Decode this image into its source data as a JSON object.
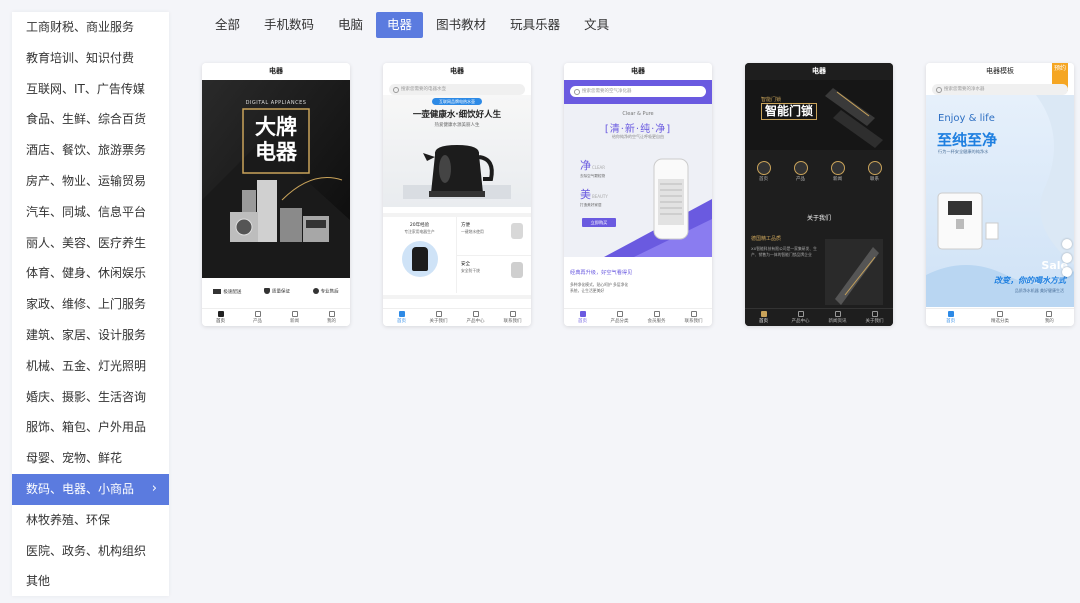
{
  "sidebar": {
    "items": [
      {
        "label": "工商财税、商业服务"
      },
      {
        "label": "教育培训、知识付费"
      },
      {
        "label": "互联网、IT、广告传媒"
      },
      {
        "label": "食品、生鲜、综合百货"
      },
      {
        "label": "酒店、餐饮、旅游票务"
      },
      {
        "label": "房产、物业、运输贸易"
      },
      {
        "label": "汽车、同城、信息平台"
      },
      {
        "label": "丽人、美容、医疗养生"
      },
      {
        "label": "体育、健身、休闲娱乐"
      },
      {
        "label": "家政、维修、上门服务"
      },
      {
        "label": "建筑、家居、设计服务"
      },
      {
        "label": "机械、五金、灯光照明"
      },
      {
        "label": "婚庆、摄影、生活咨询"
      },
      {
        "label": "服饰、箱包、户外用品"
      },
      {
        "label": "母婴、宠物、鲜花"
      },
      {
        "label": "数码、电器、小商品"
      },
      {
        "label": "林牧养殖、环保"
      },
      {
        "label": "医院、政务、机构组织"
      },
      {
        "label": "其他"
      }
    ],
    "active_index": 15,
    "chevron": "›"
  },
  "tabs": [
    "全部",
    "手机数码",
    "电脑",
    "电器",
    "图书教材",
    "玩具乐器",
    "文具"
  ],
  "active_tab": 3,
  "colors": {
    "accent": "#5b7bdf",
    "purple": "#6a5ae0",
    "blue": "#2d8ae6"
  },
  "cards": {
    "c1": {
      "title": "电器",
      "brand_en": "DIGITAL APPLIANCES",
      "headline_1": "大牌",
      "headline_2": "电器",
      "features": [
        "极速配送",
        "质量保证",
        "专业售后"
      ],
      "nav": [
        "首页",
        "产品",
        "新闻",
        "我的"
      ]
    },
    "c2": {
      "title": "电器",
      "search": "搜索您需要的电器水壶",
      "badge": "互联网品牌电热水壶",
      "headline": "一壶健康水·细饮好人生",
      "sub": "热爱健康水源美丽人生",
      "grid": [
        {
          "t": "20年经验",
          "s": "专注家用电器生产"
        },
        {
          "t": "方便",
          "s": "一键烧水使用"
        },
        {
          "t": "安全",
          "s": "安全防干烧"
        }
      ],
      "section": "产品实力·值得信赖",
      "nav": [
        "首页",
        "关于我们",
        "产品中心",
        "联系我们"
      ]
    },
    "c3": {
      "title": "电器",
      "search": "搜索您需要的空气净化器",
      "en": "Clear & Pure",
      "headline": "[清·新·纯·净]",
      "sub": "给你纯净的空气让呼吸更自由",
      "clear": "净",
      "clear_en": "CLEAR",
      "beauty": "美",
      "beauty_en": "BEAUTY",
      "clear_desc": "去除空气颗粒物",
      "beauty_desc": "打造美好家居",
      "btn": "立即购买",
      "section": "经典再升级，好空气看得见",
      "desc": "多种净化模式，贴心呵护 多层净化系统，让生活更美好",
      "nav": [
        "首页",
        "产品分类",
        "会员服务",
        "联系我们"
      ]
    },
    "c4": {
      "title": "电器",
      "headline": "智能门锁",
      "sub": "智能门锁",
      "icons": [
        "首页",
        "产品",
        "新闻",
        "联系"
      ],
      "section": "关于我们",
      "highlight": "德国精工品质",
      "desc": "XX智能科技有限公司是一家集研发、生产、销售为一体的智能门锁品牌企业",
      "nav": [
        "首页",
        "产品中心",
        "新闻资讯",
        "关于我们"
      ]
    },
    "c5": {
      "title": "电器模板",
      "tag": "预约",
      "search": "搜索您需要的净水器",
      "en": "Enjoy & life",
      "headline": "至纯至净",
      "sub": "行为一杯安全健康的纯净水",
      "slogan": "改变，你的喝水方式",
      "slogan2": "品质净水机器 美好健康生活",
      "sale": "Sale",
      "nav": [
        "首页",
        "精选分类",
        "我的"
      ]
    }
  }
}
